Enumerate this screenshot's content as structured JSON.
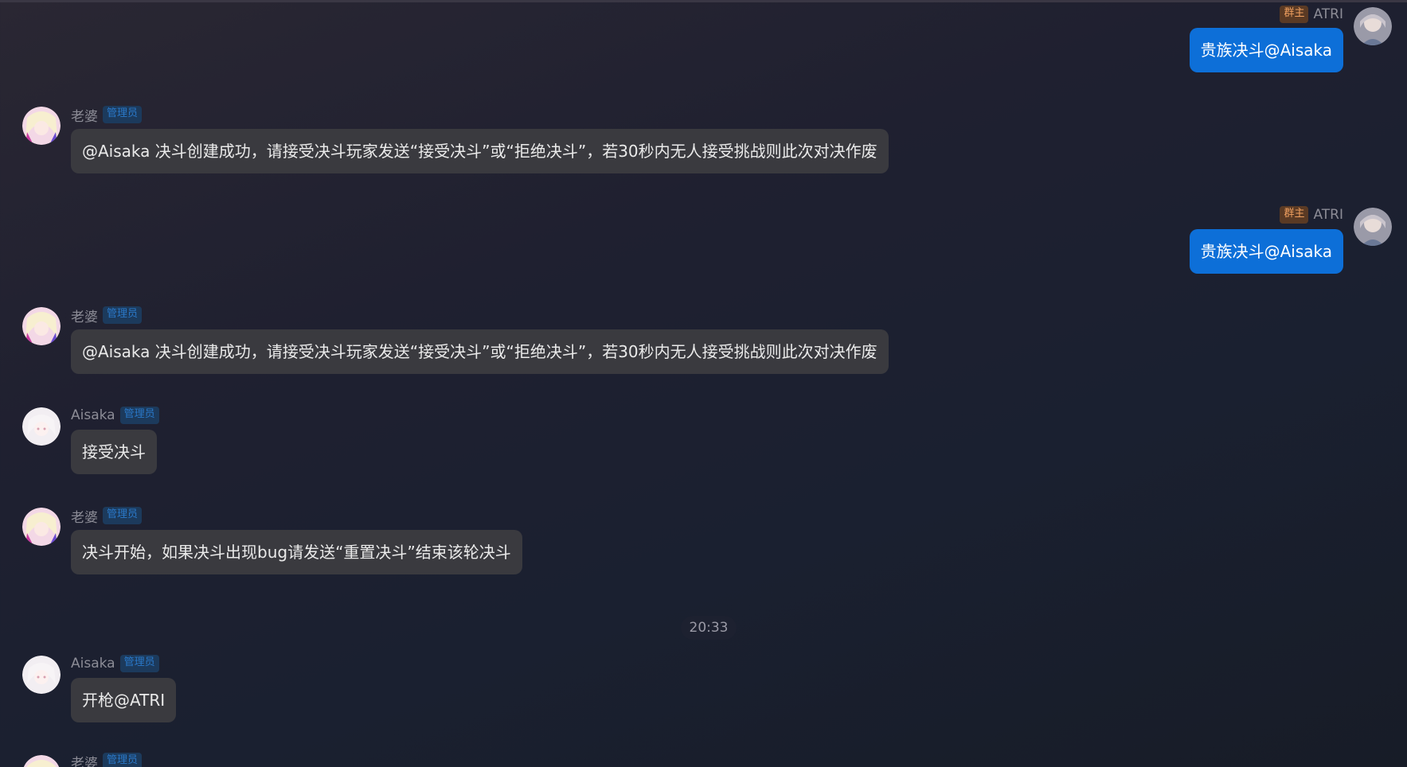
{
  "messages": [
    {
      "sender": "ATRI",
      "badge": "群主",
      "text": "贵族决斗@Aisaka",
      "side": "right",
      "avatar": "atri-avatar"
    },
    {
      "sender": "老婆",
      "badge": "管理员",
      "text": "@Aisaka 决斗创建成功，请接受决斗玩家发送“接受决斗”或“拒绝决斗”，若30秒内无人接受挑战则此次对决作废",
      "side": "left",
      "avatar": "laopo-avatar"
    },
    {
      "sender": "ATRI",
      "badge": "群主",
      "text": "贵族决斗@Aisaka",
      "side": "right",
      "avatar": "atri-avatar"
    },
    {
      "sender": "老婆",
      "badge": "管理员",
      "text": "@Aisaka 决斗创建成功，请接受决斗玩家发送“接受决斗”或“拒绝决斗”，若30秒内无人接受挑战则此次对决作废",
      "side": "left",
      "avatar": "laopo-avatar"
    },
    {
      "sender": "Aisaka",
      "badge": "管理员",
      "text": "接受决斗",
      "side": "left",
      "avatar": "aisaka-avatar"
    },
    {
      "sender": "老婆",
      "badge": "管理员",
      "text": "决斗开始，如果决斗出现bug请发送“重置决斗”结束该轮决斗",
      "side": "left",
      "avatar": "laopo-avatar"
    },
    {
      "sender": "Aisaka",
      "badge": "管理员",
      "text": "开枪@ATRI",
      "side": "left",
      "avatar": "aisaka-avatar"
    },
    {
      "sender": "老婆",
      "badge": "管理员",
      "text": "",
      "side": "left",
      "avatar": "laopo-avatar"
    }
  ],
  "timestamp": "20:33",
  "colors": {
    "outgoing_bubble": "#0d6fd8",
    "incoming_bubble": "#3a3a3f",
    "admin_badge": "#2a78c8",
    "owner_badge": "#f0a060"
  }
}
